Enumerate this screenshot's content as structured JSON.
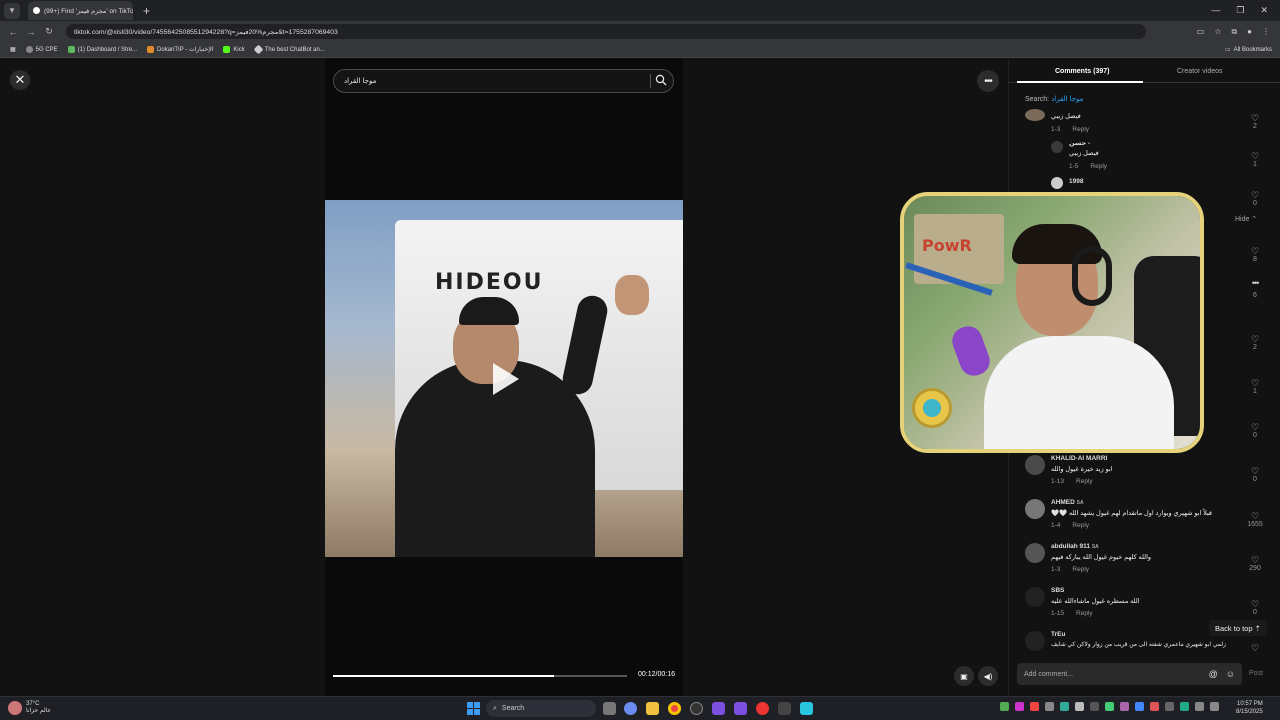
{
  "browser": {
    "tab_title": "(99+) Find 'مجرم فيمز' on TikTok",
    "url": "tiktok.com/@xisll30/video/7455642508551294228?q=مجرم%20فيمز&t=1755287069403",
    "bookmarks": [
      "5G CPE",
      "(1) Dashboard / Stre...",
      "DokanTIP - الإختبارات",
      "Kick",
      "The best ChatBot an..."
    ],
    "all_bookmarks": "All Bookmarks"
  },
  "search": {
    "value": "موجا القراد"
  },
  "player": {
    "time": "00:12/00:16",
    "progress": 0.75
  },
  "panel": {
    "tabs": {
      "comments": "Comments (397)",
      "creator": "Creator videos"
    },
    "search_prefix": "Search:",
    "search_query": "موجا القراد",
    "hide": "Hide",
    "back_to_top": "Back to top",
    "composer_placeholder": "Add comment...",
    "post": "Post",
    "comments": [
      {
        "name": "",
        "text": "فيصل زيبي",
        "date": "1-3",
        "reply": "Reply",
        "likes": "2"
      },
      {
        "name": "حسن -",
        "text": "فيصل زيبي",
        "date": "1-5",
        "reply": "Reply",
        "likes": "1"
      },
      {
        "name": "1998",
        "text": "",
        "date": "",
        "reply": "",
        "likes": "0"
      },
      {
        "name": "",
        "text": "",
        "date": "",
        "reply": "",
        "likes": "8"
      },
      {
        "name": "",
        "text": "",
        "date": "",
        "reply": "",
        "likes": "6"
      },
      {
        "name": "",
        "text": "",
        "date": "",
        "reply": "",
        "likes": "2"
      },
      {
        "name": "",
        "text": "",
        "date": "",
        "reply": "",
        "likes": "1"
      },
      {
        "name": "",
        "text": "",
        "date": "",
        "reply": "",
        "likes": "0"
      },
      {
        "name": "KHALID-Al MARRI",
        "text": "ابو زيد خيرة غيول والله",
        "date": "1-13",
        "reply": "Reply",
        "likes": "0"
      },
      {
        "name": "AHMED",
        "text": "قبلاً ابو شهيري ويوارد اول ماتقدام لهم غيول يشهد الله 🤍🤍",
        "date": "1-4",
        "reply": "Reply",
        "likes": "1655"
      },
      {
        "name": "abdullah 911",
        "text": "والله كلهم خيوم غيول الله يباركه فيهم",
        "date": "1-3",
        "reply": "Reply",
        "likes": "290"
      },
      {
        "name": "SBS",
        "text": "الله مسطره غيول ماشاءالله عليه",
        "date": "1-15",
        "reply": "Reply",
        "likes": "0"
      },
      {
        "name": "TrEu",
        "text": "زلمي ابو شهيري ماعمري شفته الى من قريب من زوار ولاكن كي شايف",
        "date": "",
        "reply": "",
        "likes": ""
      }
    ],
    "badge_sa": "SA"
  },
  "overlay": {
    "poster_text": "PowR"
  },
  "taskbar": {
    "temp": "37°C",
    "weather_desc": "عالم حزانا",
    "search": "Search",
    "time": "10:57 PM",
    "date": "8/15/2025"
  },
  "colors": {
    "accent": "#2aa7ff",
    "border_overlay": "#e6d27a"
  }
}
